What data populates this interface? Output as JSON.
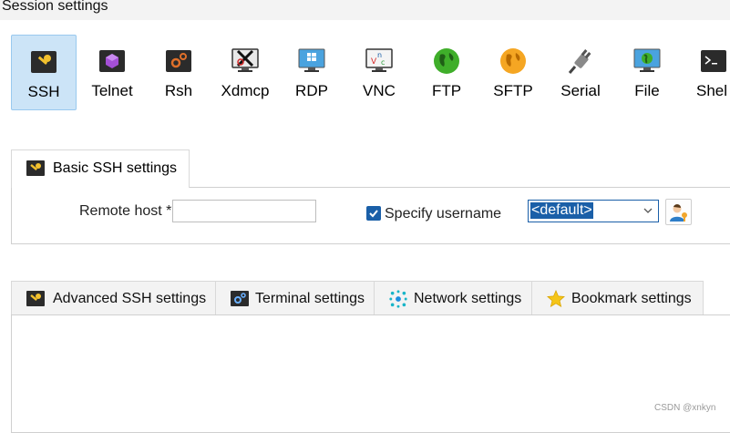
{
  "window": {
    "title": "Session settings"
  },
  "session_types": [
    {
      "label": "SSH",
      "icon": "ssh-key-icon",
      "selected": true
    },
    {
      "label": "Telnet",
      "icon": "telnet-icon"
    },
    {
      "label": "Rsh",
      "icon": "rsh-icon"
    },
    {
      "label": "Xdmcp",
      "icon": "xdmcp-icon"
    },
    {
      "label": "RDP",
      "icon": "rdp-icon"
    },
    {
      "label": "VNC",
      "icon": "vnc-icon"
    },
    {
      "label": "FTP",
      "icon": "ftp-globe-icon"
    },
    {
      "label": "SFTP",
      "icon": "sftp-globe-icon"
    },
    {
      "label": "Serial",
      "icon": "serial-plug-icon"
    },
    {
      "label": "File",
      "icon": "file-monitor-icon"
    },
    {
      "label": "Shel",
      "icon": "shell-terminal-icon"
    }
  ],
  "basic_tab": {
    "label": "Basic SSH settings"
  },
  "remote_host": {
    "label": "Remote host *",
    "value": ""
  },
  "specify_username": {
    "label": "Specify username",
    "checked": true
  },
  "username": {
    "value": "<default>"
  },
  "lower_tabs": [
    {
      "label": "Advanced SSH settings",
      "icon": "ssh-key-icon"
    },
    {
      "label": "Terminal settings",
      "icon": "terminal-gears-icon"
    },
    {
      "label": "Network settings",
      "icon": "network-icon"
    },
    {
      "label": "Bookmark settings",
      "icon": "star-icon"
    }
  ],
  "watermark": "CSDN @xnkyn",
  "colors": {
    "accent": "#1a5fa8",
    "selected_bg": "#cce4f7"
  }
}
